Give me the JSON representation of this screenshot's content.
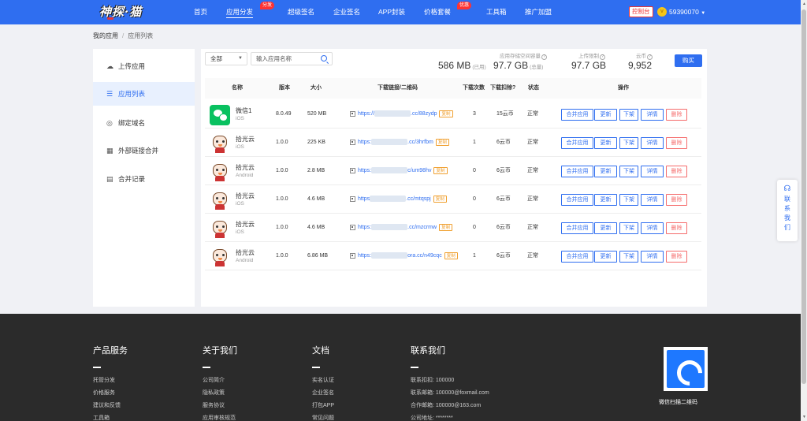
{
  "nav": {
    "logo": "神探·猫",
    "items": [
      {
        "label": "首页"
      },
      {
        "label": "应用分发",
        "badge": "分发"
      },
      {
        "label": "超级签名"
      },
      {
        "label": "企业签名"
      },
      {
        "label": "APP封装"
      },
      {
        "label": "价格套餐",
        "badge": "优惠"
      },
      {
        "label": "工具箱"
      },
      {
        "label": "推广加盟"
      }
    ],
    "console_label": "控制台",
    "coin_icon": "coin-icon",
    "balance": "59390070"
  },
  "breadcrumb": {
    "root": "我的应用",
    "separator": "/",
    "current": "应用列表"
  },
  "sidebar": {
    "items": [
      {
        "label": "上传应用",
        "icon": "cloud-upload-icon"
      },
      {
        "label": "应用列表",
        "icon": "list-icon"
      },
      {
        "label": "绑定域名",
        "icon": "globe-icon"
      },
      {
        "label": "外部链接合并",
        "icon": "grid-icon"
      },
      {
        "label": "合并记录",
        "icon": "document-icon"
      }
    ]
  },
  "toolbar": {
    "filter_value": "全部",
    "search_placeholder": "输入应用名称",
    "buy_label": "购买"
  },
  "stats": {
    "storage_label": "应用存储空间容量",
    "storage_used": "586 MB",
    "storage_used_suffix": "(已用)",
    "storage_total": "97.7 GB",
    "storage_total_suffix": "(总量)",
    "upload_label": "上传限制",
    "upload_value": "97.7 GB",
    "coin_label": "云币",
    "coin_value": "9,952"
  },
  "table": {
    "headers": [
      "名称",
      "版本",
      "大小",
      "下载链接/二维码",
      "下载次数",
      "下载扣除?",
      "状态",
      "操作"
    ],
    "actions": [
      "合并应用",
      "更新",
      "下架",
      "详情",
      "删除"
    ],
    "copy_tag": "复制",
    "rows": [
      {
        "name": "微信1",
        "platform": "iOS",
        "icon": "wechat-icon",
        "version": "8.0.49",
        "size": "520 MB",
        "link_prefix": "https://",
        "link_suffix": ".cc/88zydp",
        "downloads": "3",
        "cost": "15云币",
        "status": "正常"
      },
      {
        "name": "拾光云",
        "platform": "iOS",
        "icon": "cat-app-icon",
        "version": "1.0.0",
        "size": "225 KB",
        "link_prefix": "https:",
        "link_suffix": ".cc/3hrfbm",
        "downloads": "1",
        "cost": "6云币",
        "status": "正常"
      },
      {
        "name": "拾光云",
        "platform": "Android",
        "icon": "cat-app-icon",
        "version": "1.0.0",
        "size": "2.8 MB",
        "link_prefix": "https:",
        "link_suffix": "c/um98hv",
        "downloads": "0",
        "cost": "6云币",
        "status": "正常"
      },
      {
        "name": "拾光云",
        "platform": "iOS",
        "icon": "cat-app-icon",
        "version": "1.0.0",
        "size": "4.6 MB",
        "link_prefix": "https",
        "link_suffix": ".cc/mtqspj",
        "downloads": "0",
        "cost": "6云币",
        "status": "正常"
      },
      {
        "name": "拾光云",
        "platform": "iOS",
        "icon": "cat-app-icon",
        "version": "1.0.0",
        "size": "4.6 MB",
        "link_prefix": "https:",
        "link_suffix": ".cc/mzcrmw",
        "downloads": "0",
        "cost": "6云币",
        "status": "正常"
      },
      {
        "name": "拾光云",
        "platform": "Android",
        "icon": "cat-app-icon",
        "version": "1.0.0",
        "size": "6.86 MB",
        "link_prefix": "https:",
        "link_suffix": "ora.cc/n49cqc",
        "downloads": "1",
        "cost": "6云币",
        "status": "正常"
      }
    ]
  },
  "contact": {
    "icon": "headset-icon",
    "label": "联系我们"
  },
  "footer": {
    "columns": [
      {
        "title": "产品服务",
        "links": [
          "托管分发",
          "价格服务",
          "建议和反馈",
          "工具箱"
        ]
      },
      {
        "title": "关于我们",
        "links": [
          "公司简介",
          "隐私政策",
          "服务协议",
          "应用审核规范"
        ]
      },
      {
        "title": "文档",
        "links": [
          "实名认证",
          "企业签名",
          "打包APP",
          "常见问题"
        ]
      },
      {
        "title": "联系我们",
        "links": [
          "联系扣扣: 100000",
          "联系邮箱: 100000@foxmail.com",
          "合作邮箱: 100000@163.com",
          "公司地址: ********"
        ]
      }
    ],
    "qr_label": "微信扫描二维码"
  },
  "colors": {
    "primary": "#2f6ef0",
    "danger": "#f56c6c",
    "footer_bg": "#2b2b2b",
    "copy_tag": "#f0a030"
  }
}
